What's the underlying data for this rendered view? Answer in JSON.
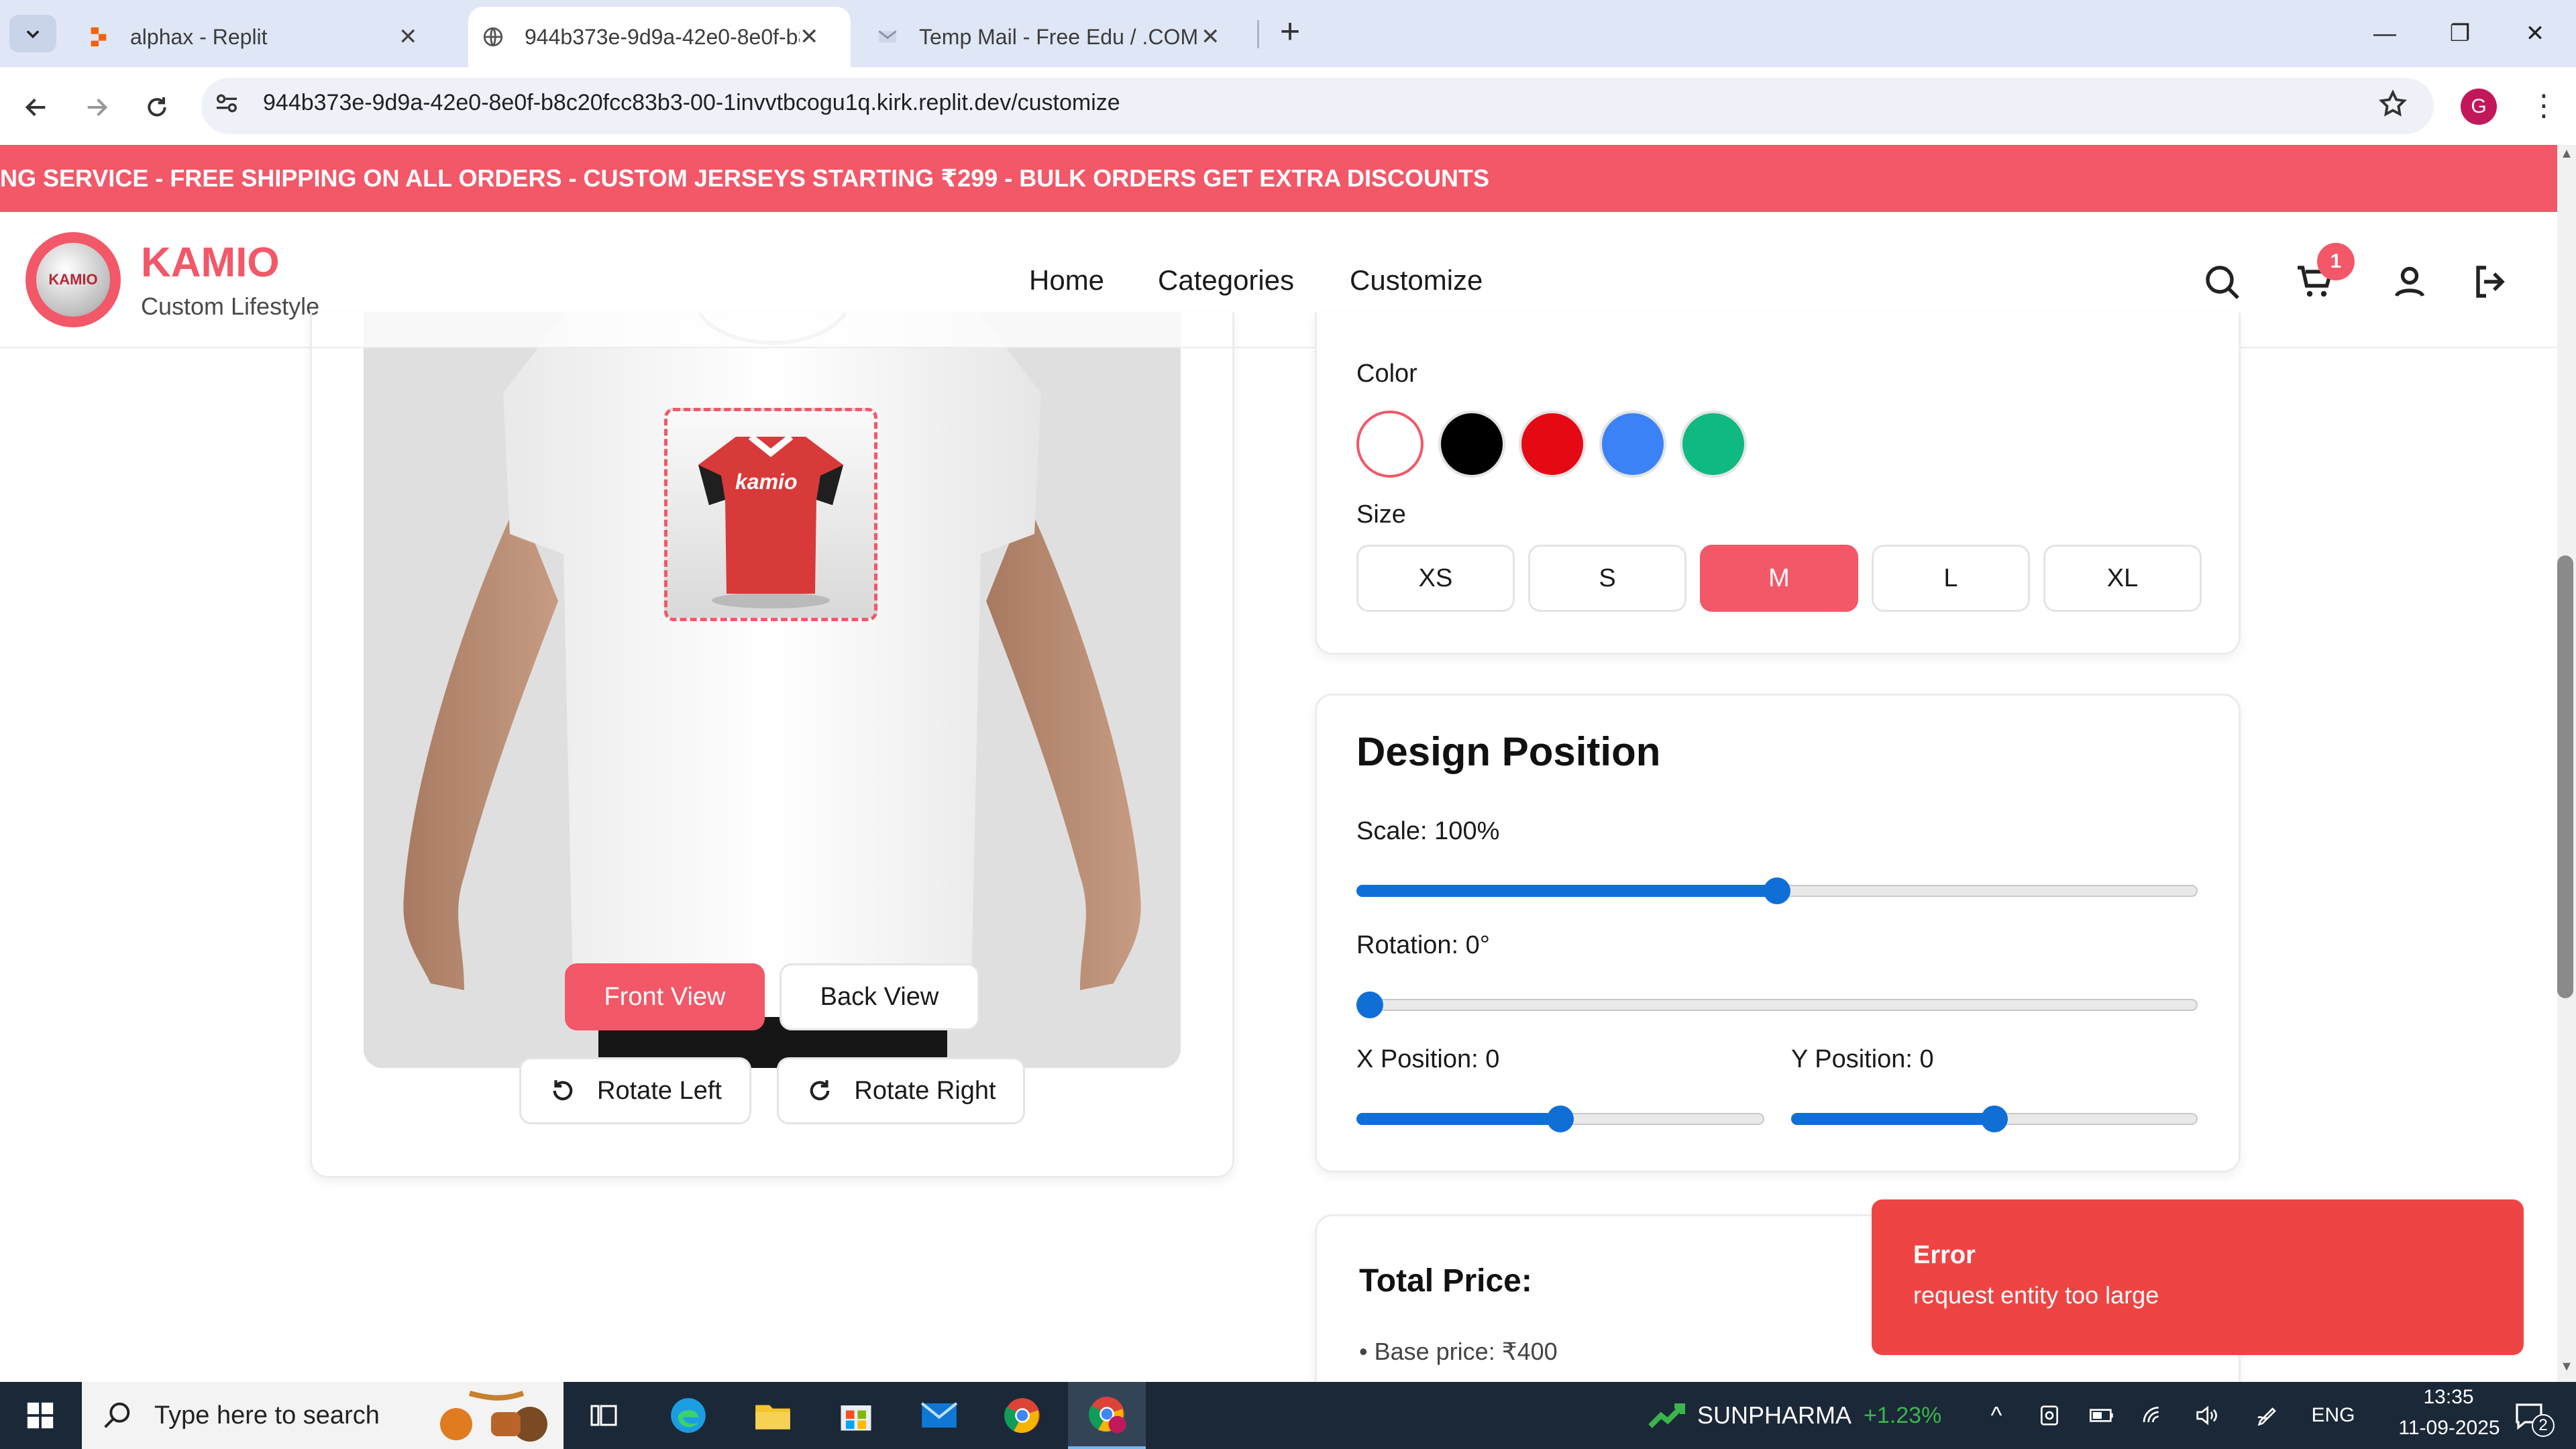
{
  "browser": {
    "tabs": [
      {
        "title": "alphax - Replit",
        "active": false
      },
      {
        "title": "944b373e-9d9a-42e0-8e0f-b8c",
        "active": true
      },
      {
        "title": "Temp Mail - Free Edu / .COM Te",
        "active": false
      }
    ],
    "new_tab": "+",
    "url": "944b373e-9d9a-42e0-8e0f-b8c20fcc83b3-00-1invvtbcogu1q.kirk.replit.dev/customize",
    "profile_initial": "G"
  },
  "promo_banner": "NG SERVICE - FREE SHIPPING ON ALL ORDERS - CUSTOM JERSEYS STARTING ₹299 - BULK ORDERS GET EXTRA DISCOUNTS",
  "header": {
    "logo_text": "KAMIO",
    "brand": "KAMIO",
    "tagline": "Custom Lifestyle",
    "nav": [
      "Home",
      "Categories",
      "Customize"
    ],
    "cart_count": "1"
  },
  "preview": {
    "design_text": "kamio",
    "view_buttons": [
      "Front View",
      "Back View"
    ],
    "rotate_buttons": [
      "Rotate Left",
      "Rotate Right"
    ]
  },
  "options": {
    "color_label": "Color",
    "colors": [
      "#ffffff",
      "#000000",
      "#e50914",
      "#3b82f6",
      "#10b981"
    ],
    "selected_color": "#ffffff",
    "size_label": "Size",
    "sizes": [
      "XS",
      "S",
      "M",
      "L",
      "XL"
    ],
    "selected_size": "M"
  },
  "design_position": {
    "title": "Design Position",
    "scale_label": "Scale: 100%",
    "scale_level": 0.5,
    "rotation_label": "Rotation: 0°",
    "rotation_level": 0.0,
    "x_label": "X Position: 0",
    "x_level": 0.5,
    "y_label": "Y Position: 0",
    "y_level": 0.5
  },
  "price": {
    "title": "Total Price:",
    "base": "• Base price: ₹400"
  },
  "toast": {
    "title": "Error",
    "message": "request entity too large"
  },
  "taskbar": {
    "search_placeholder": "Type here to search",
    "stock_name": "SUNPHARMA",
    "stock_change": "+1.23%",
    "lang": "ENG",
    "time": "13:35",
    "date": "11-09-2025",
    "notification_count": "2"
  },
  "colors": {
    "accent": "#f25868",
    "slider": "#0f6fd6",
    "error": "#ef4444"
  }
}
